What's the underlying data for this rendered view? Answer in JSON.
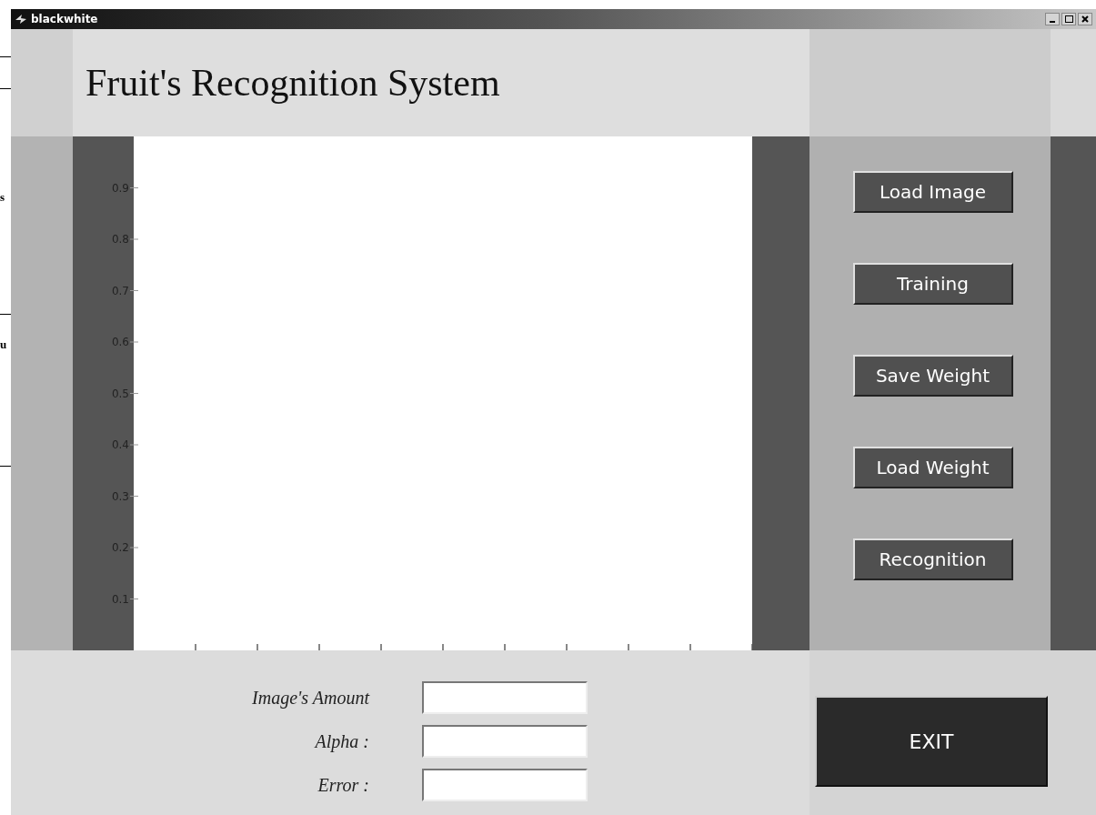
{
  "background_fragments": [
    "s",
    "u"
  ],
  "window": {
    "title": "blackwhite"
  },
  "header": {
    "title": "Fruit's Recognition System"
  },
  "axes": {
    "y_tick_labels": [
      "0.9",
      "0.8",
      "0.7",
      "0.6",
      "0.5",
      "0.4",
      "0.3",
      "0.2",
      "0.1"
    ]
  },
  "buttons": [
    "Load Image",
    "Training",
    "Save Weight",
    "Load Weight",
    "Recognition"
  ],
  "fields": [
    {
      "label": "Image's Amount"
    },
    {
      "label": "Alpha :"
    },
    {
      "label": "Error :"
    }
  ],
  "exit_button": "EXIT"
}
